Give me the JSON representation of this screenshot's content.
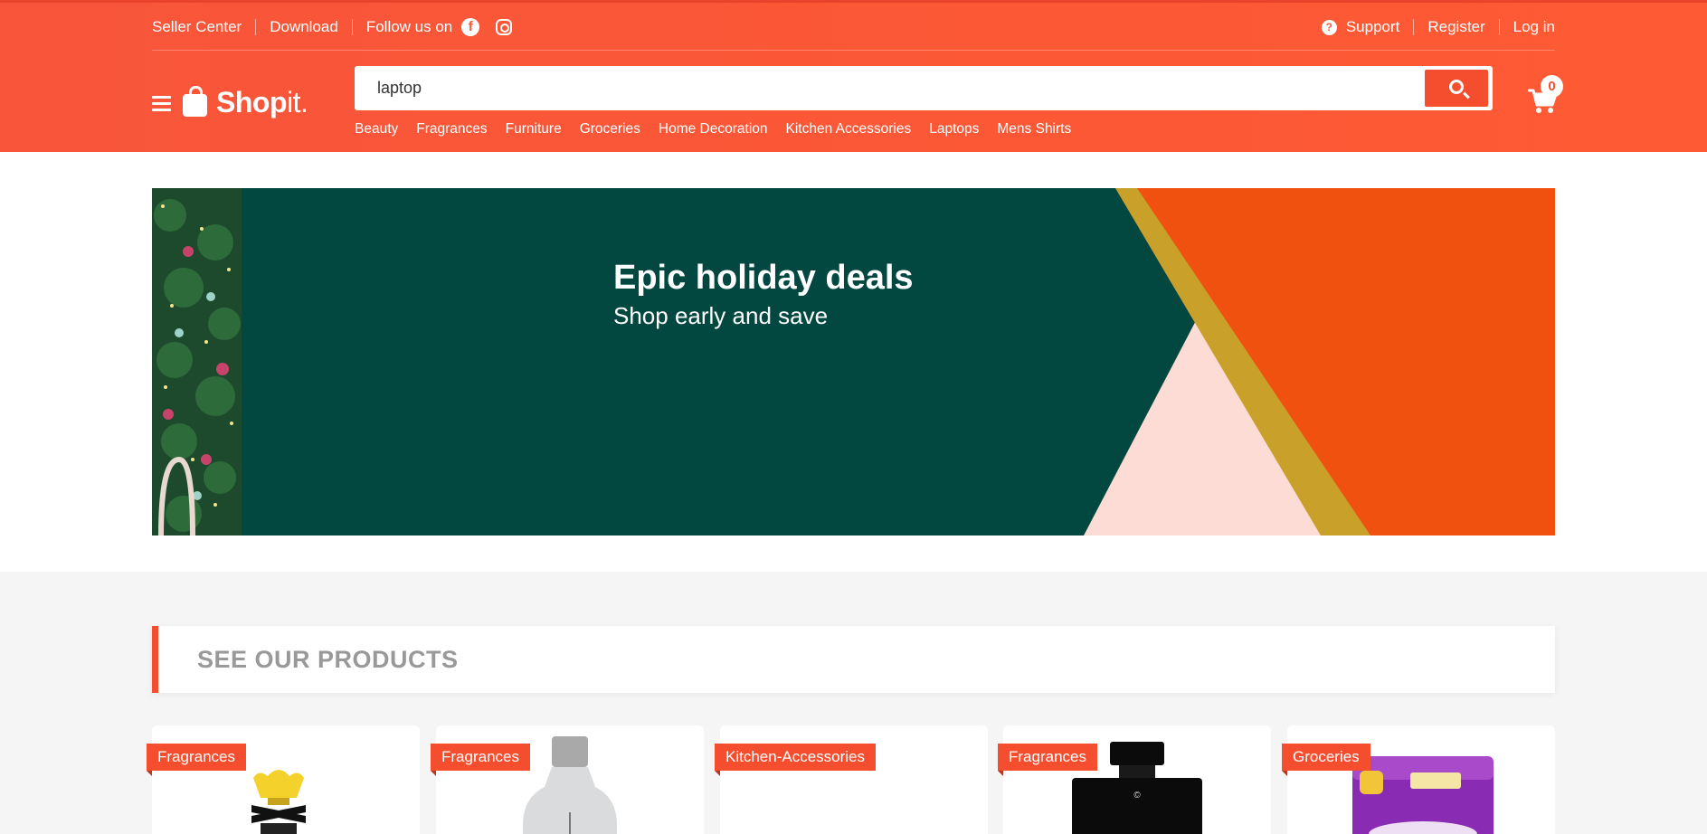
{
  "topbar": {
    "seller_center": "Seller Center",
    "download": "Download",
    "follow_us": "Follow us on",
    "support": "Support",
    "register": "Register",
    "login": "Log in"
  },
  "logo": {
    "bold": "Shop",
    "light": "it."
  },
  "search": {
    "value": "laptop"
  },
  "categories": [
    "Beauty",
    "Fragrances",
    "Furniture",
    "Groceries",
    "Home Decoration",
    "Kitchen Accessories",
    "Laptops",
    "Mens Shirts"
  ],
  "cart": {
    "count": "0"
  },
  "banner": {
    "title": "Epic holiday deals",
    "subtitle": "Shop early and save"
  },
  "products_section": {
    "title": "SEE OUR PRODUCTS"
  },
  "products": [
    {
      "category": "Fragrances"
    },
    {
      "category": "Fragrances"
    },
    {
      "category": "Kitchen-Accessories"
    },
    {
      "category": "Fragrances"
    },
    {
      "category": "Groceries"
    }
  ],
  "colors": {
    "brand": "#fe5a34",
    "banner_green": "#024841",
    "banner_orange": "#f0510f",
    "banner_pink": "#fcdcd4",
    "gold": "#c9a12a"
  },
  "icons": [
    "menu-icon",
    "shopping-bag-icon",
    "facebook-icon",
    "instagram-icon",
    "question-icon",
    "search-icon",
    "cart-icon"
  ]
}
